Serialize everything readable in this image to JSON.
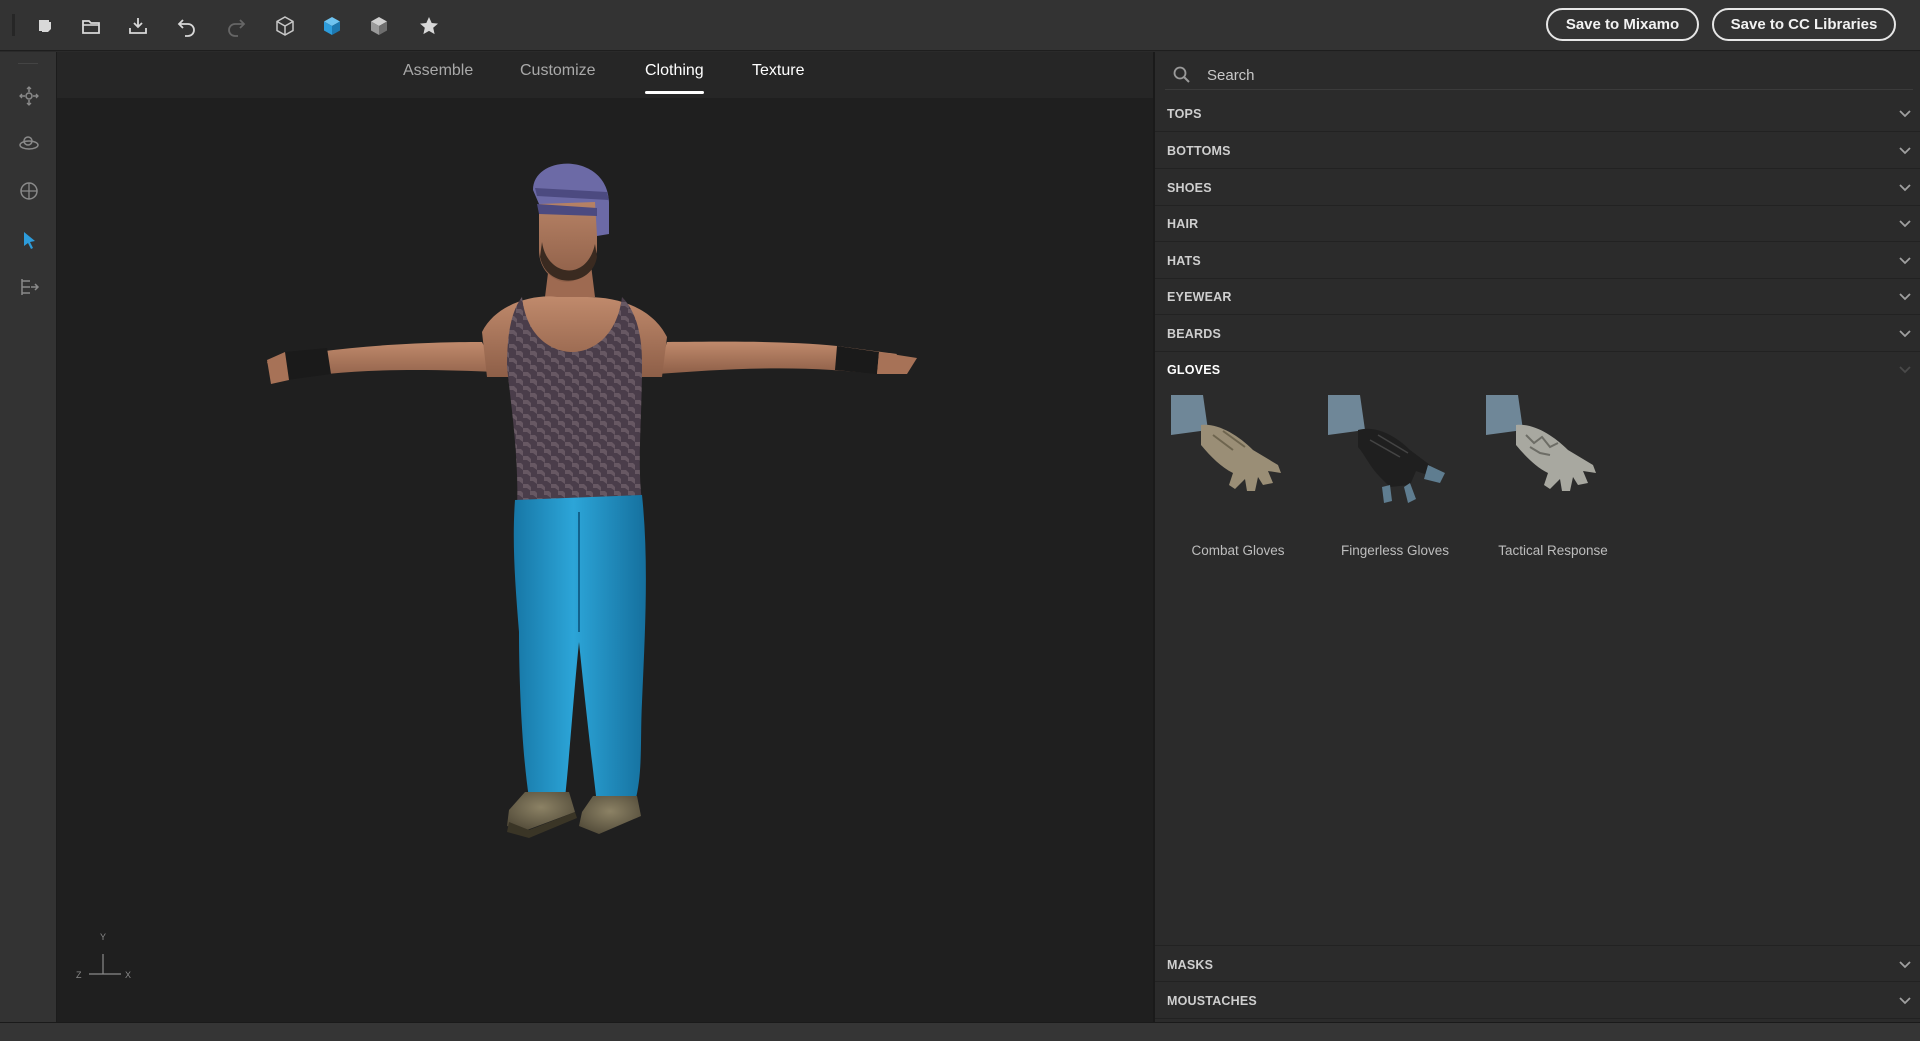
{
  "toolbar": {
    "icons": [
      "new-icon",
      "open-folder-icon",
      "export-icon",
      "undo-icon",
      "redo-icon",
      "wireframe-cube-icon",
      "solid-cube-icon",
      "shaded-cube-icon",
      "star-icon"
    ],
    "save_mixamo_label": "Save to Mixamo",
    "save_cc_label": "Save to CC Libraries"
  },
  "left_tools": [
    "move-icon",
    "orbit-icon",
    "target-icon",
    "select-pointer-icon",
    "export-arrow-icon"
  ],
  "tabs": [
    {
      "label": "Assemble",
      "state": "normal"
    },
    {
      "label": "Customize",
      "state": "normal"
    },
    {
      "label": "Clothing",
      "state": "active"
    },
    {
      "label": "Texture",
      "state": "normal"
    }
  ],
  "axis": {
    "y": "Y",
    "z": "Z",
    "x": "X"
  },
  "panel": {
    "search_placeholder": "Search",
    "categories": [
      {
        "label": "TOPS",
        "expanded": false
      },
      {
        "label": "BOTTOMS",
        "expanded": false
      },
      {
        "label": "SHOES",
        "expanded": false
      },
      {
        "label": "HAIR",
        "expanded": false
      },
      {
        "label": "HATS",
        "expanded": false
      },
      {
        "label": "EYEWEAR",
        "expanded": false
      },
      {
        "label": "BEARDS",
        "expanded": false
      },
      {
        "label": "GLOVES",
        "expanded": true
      }
    ],
    "gloves": [
      {
        "label": "Combat Gloves",
        "color": "#9a8e76"
      },
      {
        "label": "Fingerless Gloves",
        "color": "#1f1f1f"
      },
      {
        "label": "Tactical Response",
        "color": "#a8a8a0"
      }
    ],
    "bottom_categories": [
      {
        "label": "MASKS"
      },
      {
        "label": "MOUSTACHES"
      }
    ]
  },
  "colors": {
    "accent_blue": "#2d9cdb",
    "pants": "#1f97c9",
    "beanie": "#6c6aa6",
    "tank_top": "#4a3d48",
    "skin": "#b07a60"
  }
}
